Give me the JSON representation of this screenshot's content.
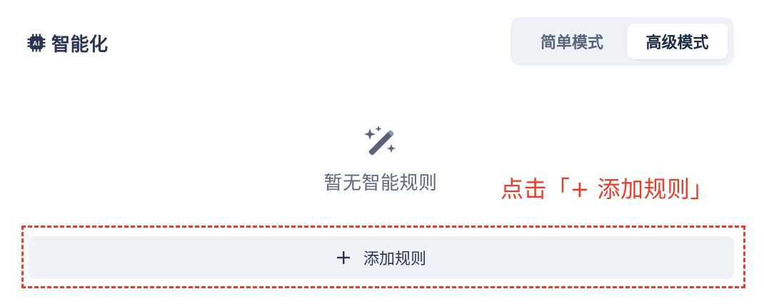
{
  "header": {
    "title": "智能化",
    "icon": "ai-chip-icon"
  },
  "mode_switch": {
    "simple_label": "简单模式",
    "advanced_label": "高级模式",
    "selected": "高级模式"
  },
  "empty_state": {
    "icon": "magic-wand-icon",
    "text": "暂无智能规则"
  },
  "annotation": {
    "text": "点击「+ 添加规则」",
    "color": "#ee3b27"
  },
  "add_rule": {
    "icon": "plus-icon",
    "label": "添加规则"
  },
  "colors": {
    "text_primary": "#2b3553",
    "text_secondary": "#5c6880",
    "surface": "#eef1f6",
    "highlight": "#ee3b27"
  }
}
